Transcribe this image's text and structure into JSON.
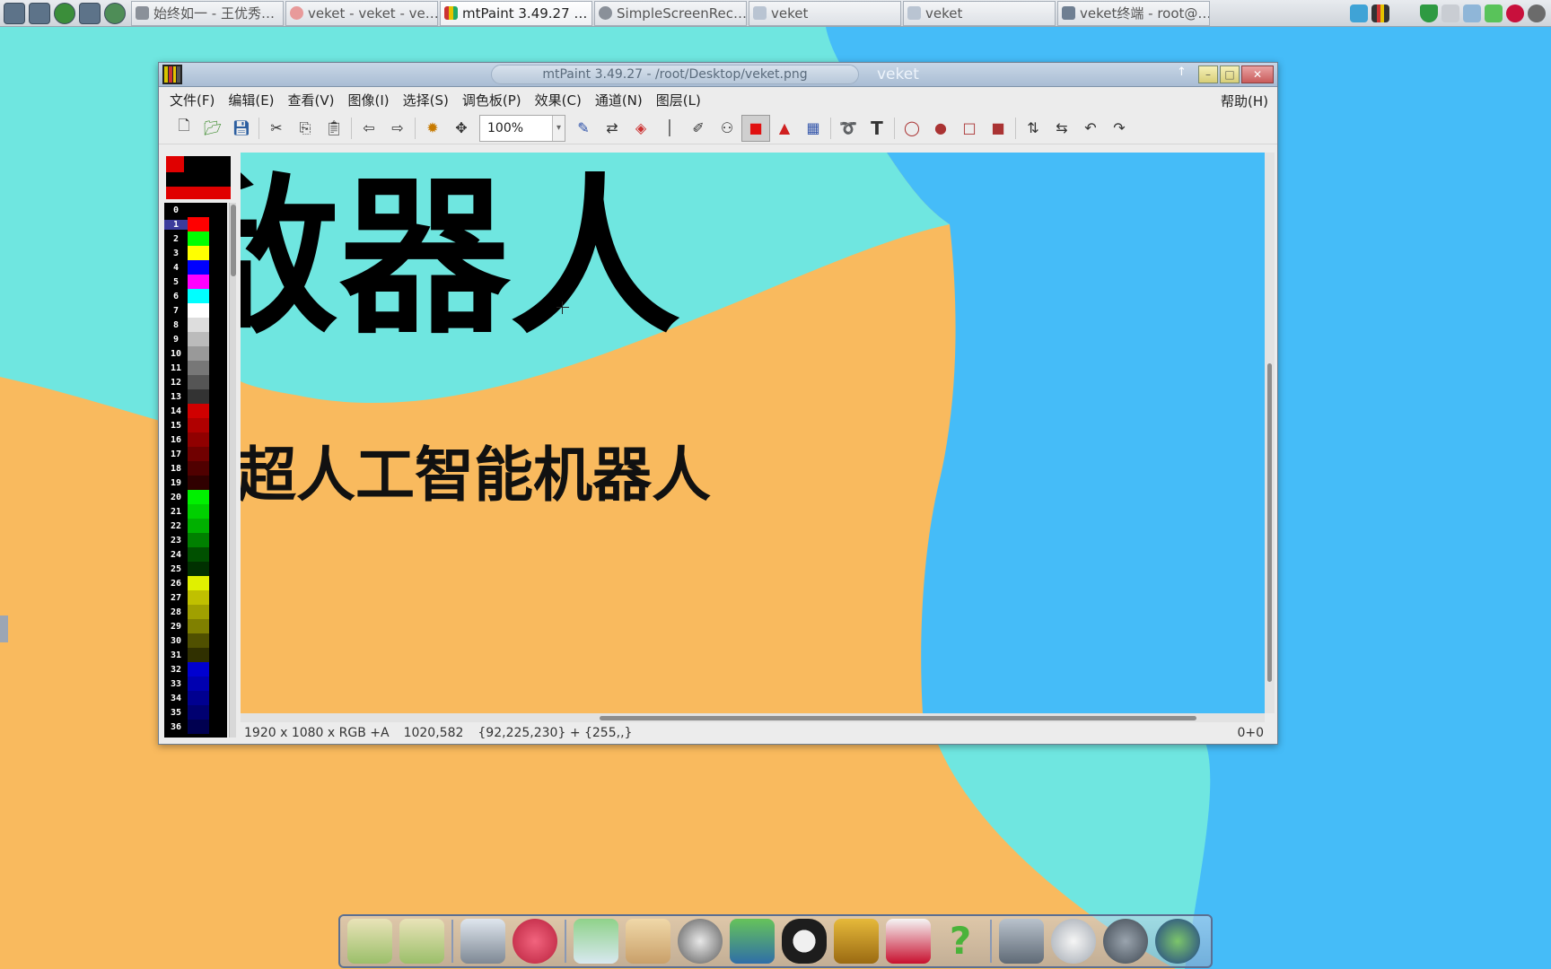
{
  "taskbar": {
    "launchers": [
      "system-monitor-icon",
      "settings-icon",
      "play-icon",
      "terminal-icon",
      "globe-icon"
    ],
    "tasks": [
      {
        "icon": "record-icon",
        "label": "始终如一 - 王优秀…"
      },
      {
        "icon": "browser-icon",
        "label": "veket - veket - ve…"
      },
      {
        "icon": "mtpaint-icon",
        "label": "mtPaint 3.49.27 …",
        "active": true
      },
      {
        "icon": "record-icon",
        "label": "SimpleScreenRec…"
      },
      {
        "icon": "folder-icon",
        "label": "veket"
      },
      {
        "icon": "folder-icon",
        "label": "veket"
      },
      {
        "icon": "terminal-icon",
        "label": "veket终端 - root@…"
      }
    ]
  },
  "window": {
    "title": "mtPaint 3.49.27 - /root/Desktop/veket.png",
    "title_right": "veket",
    "menus": [
      "文件(F)",
      "编辑(E)",
      "查看(V)",
      "图像(I)",
      "选择(S)",
      "调色板(P)",
      "效果(C)",
      "通道(N)",
      "图层(L)"
    ],
    "help_menu": "帮助(H)",
    "zoom_value": "100%",
    "tools": [
      [
        "new-icon",
        "open-icon",
        "save-icon"
      ],
      [
        "cut-icon",
        "copy-icon",
        "paste-icon"
      ],
      [
        "undo-icon",
        "redo-icon"
      ],
      [
        "brightness-icon",
        "pan-icon"
      ],
      [
        "paint-icon",
        "shuffle-icon",
        "flood-fill-icon",
        "line-icon",
        "smudge-icon",
        "clone-icon",
        "selection-icon",
        "polygon-icon",
        "gradient-icon"
      ],
      [
        "lasso-icon",
        "text-icon"
      ],
      [
        "ellipse-outline-icon",
        "ellipse-fill-icon",
        "rect-outline-icon",
        "rect-fill-icon"
      ],
      [
        "flip-vertical-icon",
        "flip-horizontal-icon",
        "rotate-left-icon",
        "rotate-right-icon"
      ]
    ],
    "pressed_tool": "selection-icon",
    "palette": {
      "selected_index": "1",
      "entries": [
        {
          "idx": "0",
          "color": "#000000"
        },
        {
          "idx": "1",
          "color": "#ff0000"
        },
        {
          "idx": "2",
          "color": "#00ff00"
        },
        {
          "idx": "3",
          "color": "#ffff00"
        },
        {
          "idx": "4",
          "color": "#0000ff"
        },
        {
          "idx": "5",
          "color": "#ff00ff"
        },
        {
          "idx": "6",
          "color": "#00ffff"
        },
        {
          "idx": "7",
          "color": "#ffffff"
        },
        {
          "idx": "8",
          "color": "#dddddd"
        },
        {
          "idx": "9",
          "color": "#bbbbbb"
        },
        {
          "idx": "10",
          "color": "#999999"
        },
        {
          "idx": "11",
          "color": "#777777"
        },
        {
          "idx": "12",
          "color": "#555555"
        },
        {
          "idx": "13",
          "color": "#333333"
        },
        {
          "idx": "14",
          "color": "#d00000"
        },
        {
          "idx": "15",
          "color": "#b00000"
        },
        {
          "idx": "16",
          "color": "#900000"
        },
        {
          "idx": "17",
          "color": "#700000"
        },
        {
          "idx": "18",
          "color": "#500000"
        },
        {
          "idx": "19",
          "color": "#300000"
        },
        {
          "idx": "20",
          "color": "#00f000"
        },
        {
          "idx": "21",
          "color": "#00d000"
        },
        {
          "idx": "22",
          "color": "#00b000"
        },
        {
          "idx": "23",
          "color": "#008000"
        },
        {
          "idx": "24",
          "color": "#005000"
        },
        {
          "idx": "25",
          "color": "#003000"
        },
        {
          "idx": "26",
          "color": "#e0f000"
        },
        {
          "idx": "27",
          "color": "#c0c000"
        },
        {
          "idx": "28",
          "color": "#a0a000"
        },
        {
          "idx": "29",
          "color": "#808000"
        },
        {
          "idx": "30",
          "color": "#505000"
        },
        {
          "idx": "31",
          "color": "#303000"
        },
        {
          "idx": "32",
          "color": "#0000d0"
        },
        {
          "idx": "33",
          "color": "#0000b0"
        },
        {
          "idx": "34",
          "color": "#000090"
        },
        {
          "idx": "35",
          "color": "#000070"
        },
        {
          "idx": "36",
          "color": "#000050"
        }
      ]
    },
    "canvas": {
      "heading_text": "敌器人",
      "subheading_text": "超人工智能机器人",
      "colors": {
        "cyan": "#6fe6e0",
        "orange": "#f9ba5e",
        "blue": "#45bcf8"
      }
    },
    "status": {
      "dimensions": "1920 x 1080 x RGB +A",
      "cursor_pos": "1020,582",
      "pixel": "{92,225,230} + {255,,}",
      "selection": "0+0"
    }
  },
  "dock": {
    "items": [
      "document-icon",
      "document-icon",
      "monitor-icon",
      "mascot-icon",
      "notebook-icon",
      "paint-icon",
      "speaker-icon",
      "users-icon",
      "penguin-icon",
      "door-icon",
      "chart-icon",
      "help-icon",
      "drive-icon",
      "sun-icon",
      "globe-icon",
      "globe-icon"
    ]
  }
}
